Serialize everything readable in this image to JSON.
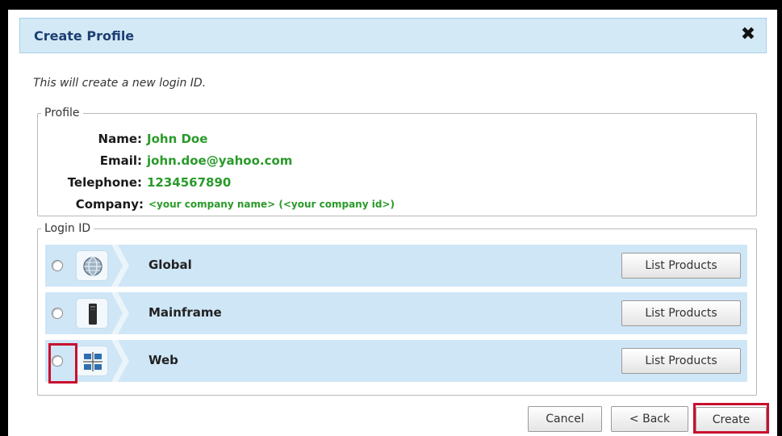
{
  "dialog": {
    "title": "Create Profile",
    "close_symbol": "✖",
    "intro": "This will create a new login ID."
  },
  "profile": {
    "legend": "Profile",
    "fields": [
      {
        "label": "Name:",
        "value": "John Doe"
      },
      {
        "label": "Email:",
        "value": "john.doe@yahoo.com"
      },
      {
        "label": "Telephone:",
        "value": "1234567890"
      },
      {
        "label": "Company:",
        "value": "<your company name> (<your company id>)"
      }
    ]
  },
  "login": {
    "legend": "Login ID",
    "options": [
      {
        "name": "Global",
        "icon": "globe-icon",
        "button": "List Products"
      },
      {
        "name": "Mainframe",
        "icon": "mainframe-icon",
        "button": "List Products"
      },
      {
        "name": "Web",
        "icon": "web-network-icon",
        "button": "List Products"
      }
    ]
  },
  "footer": {
    "cancel": "Cancel",
    "back": "< Back",
    "create": "Create"
  },
  "colors": {
    "accent_green": "#2a9a2a",
    "titlebar": "#d3e9f6",
    "row_bg": "#cfe6f6",
    "highlight_red": "#c8102e"
  }
}
